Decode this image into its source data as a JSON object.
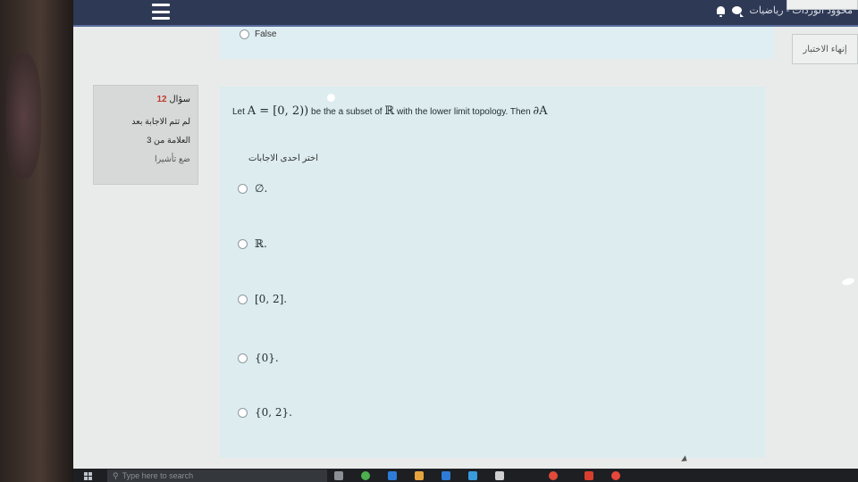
{
  "topbar": {
    "site_title": "محوود الوردات - رياضيات",
    "finish_review": "إنهاء الاختبار"
  },
  "previous_question": {
    "visible_option": "False"
  },
  "info": {
    "question_label": "سؤال",
    "question_number": "12",
    "status": "لم تتم الاجابة بعد",
    "mark": "العلامة من 3",
    "flag": "ضع تأشيرا"
  },
  "question": {
    "text_let": "Let",
    "math_set": "A = [0, 2))",
    "text_mid": "be the a subset of",
    "math_R": "ℝ",
    "text_end": "with the lower limit topology. Then",
    "math_boundary": "∂A",
    "prompt": "اختر احدى الاجابات",
    "options": [
      {
        "label": "∅."
      },
      {
        "label": "ℝ."
      },
      {
        "label": "[0, 2]."
      },
      {
        "label": "{0}."
      },
      {
        "label": "{0, 2}."
      }
    ]
  },
  "taskbar": {
    "search_placeholder": "Type here to search"
  },
  "colors": {
    "topbar": "#2e3a55",
    "question_bg": "#dcecef",
    "info_bg": "#d7d9d9"
  }
}
